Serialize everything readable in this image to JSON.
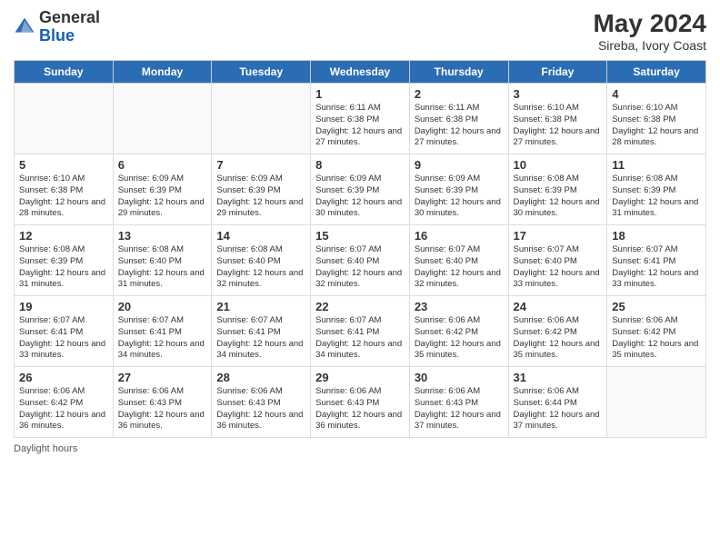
{
  "header": {
    "logo_general": "General",
    "logo_blue": "Blue",
    "month_year": "May 2024",
    "location": "Sireba, Ivory Coast"
  },
  "footer": {
    "daylight_label": "Daylight hours"
  },
  "days_of_week": [
    "Sunday",
    "Monday",
    "Tuesday",
    "Wednesday",
    "Thursday",
    "Friday",
    "Saturday"
  ],
  "weeks": [
    [
      {
        "day": "",
        "empty": true
      },
      {
        "day": "",
        "empty": true
      },
      {
        "day": "",
        "empty": true
      },
      {
        "day": "1",
        "sunrise": "Sunrise: 6:11 AM",
        "sunset": "Sunset: 6:38 PM",
        "daylight": "Daylight: 12 hours and 27 minutes."
      },
      {
        "day": "2",
        "sunrise": "Sunrise: 6:11 AM",
        "sunset": "Sunset: 6:38 PM",
        "daylight": "Daylight: 12 hours and 27 minutes."
      },
      {
        "day": "3",
        "sunrise": "Sunrise: 6:10 AM",
        "sunset": "Sunset: 6:38 PM",
        "daylight": "Daylight: 12 hours and 27 minutes."
      },
      {
        "day": "4",
        "sunrise": "Sunrise: 6:10 AM",
        "sunset": "Sunset: 6:38 PM",
        "daylight": "Daylight: 12 hours and 28 minutes."
      }
    ],
    [
      {
        "day": "5",
        "sunrise": "Sunrise: 6:10 AM",
        "sunset": "Sunset: 6:38 PM",
        "daylight": "Daylight: 12 hours and 28 minutes."
      },
      {
        "day": "6",
        "sunrise": "Sunrise: 6:09 AM",
        "sunset": "Sunset: 6:39 PM",
        "daylight": "Daylight: 12 hours and 29 minutes."
      },
      {
        "day": "7",
        "sunrise": "Sunrise: 6:09 AM",
        "sunset": "Sunset: 6:39 PM",
        "daylight": "Daylight: 12 hours and 29 minutes."
      },
      {
        "day": "8",
        "sunrise": "Sunrise: 6:09 AM",
        "sunset": "Sunset: 6:39 PM",
        "daylight": "Daylight: 12 hours and 30 minutes."
      },
      {
        "day": "9",
        "sunrise": "Sunrise: 6:09 AM",
        "sunset": "Sunset: 6:39 PM",
        "daylight": "Daylight: 12 hours and 30 minutes."
      },
      {
        "day": "10",
        "sunrise": "Sunrise: 6:08 AM",
        "sunset": "Sunset: 6:39 PM",
        "daylight": "Daylight: 12 hours and 30 minutes."
      },
      {
        "day": "11",
        "sunrise": "Sunrise: 6:08 AM",
        "sunset": "Sunset: 6:39 PM",
        "daylight": "Daylight: 12 hours and 31 minutes."
      }
    ],
    [
      {
        "day": "12",
        "sunrise": "Sunrise: 6:08 AM",
        "sunset": "Sunset: 6:39 PM",
        "daylight": "Daylight: 12 hours and 31 minutes."
      },
      {
        "day": "13",
        "sunrise": "Sunrise: 6:08 AM",
        "sunset": "Sunset: 6:40 PM",
        "daylight": "Daylight: 12 hours and 31 minutes."
      },
      {
        "day": "14",
        "sunrise": "Sunrise: 6:08 AM",
        "sunset": "Sunset: 6:40 PM",
        "daylight": "Daylight: 12 hours and 32 minutes."
      },
      {
        "day": "15",
        "sunrise": "Sunrise: 6:07 AM",
        "sunset": "Sunset: 6:40 PM",
        "daylight": "Daylight: 12 hours and 32 minutes."
      },
      {
        "day": "16",
        "sunrise": "Sunrise: 6:07 AM",
        "sunset": "Sunset: 6:40 PM",
        "daylight": "Daylight: 12 hours and 32 minutes."
      },
      {
        "day": "17",
        "sunrise": "Sunrise: 6:07 AM",
        "sunset": "Sunset: 6:40 PM",
        "daylight": "Daylight: 12 hours and 33 minutes."
      },
      {
        "day": "18",
        "sunrise": "Sunrise: 6:07 AM",
        "sunset": "Sunset: 6:41 PM",
        "daylight": "Daylight: 12 hours and 33 minutes."
      }
    ],
    [
      {
        "day": "19",
        "sunrise": "Sunrise: 6:07 AM",
        "sunset": "Sunset: 6:41 PM",
        "daylight": "Daylight: 12 hours and 33 minutes."
      },
      {
        "day": "20",
        "sunrise": "Sunrise: 6:07 AM",
        "sunset": "Sunset: 6:41 PM",
        "daylight": "Daylight: 12 hours and 34 minutes."
      },
      {
        "day": "21",
        "sunrise": "Sunrise: 6:07 AM",
        "sunset": "Sunset: 6:41 PM",
        "daylight": "Daylight: 12 hours and 34 minutes."
      },
      {
        "day": "22",
        "sunrise": "Sunrise: 6:07 AM",
        "sunset": "Sunset: 6:41 PM",
        "daylight": "Daylight: 12 hours and 34 minutes."
      },
      {
        "day": "23",
        "sunrise": "Sunrise: 6:06 AM",
        "sunset": "Sunset: 6:42 PM",
        "daylight": "Daylight: 12 hours and 35 minutes."
      },
      {
        "day": "24",
        "sunrise": "Sunrise: 6:06 AM",
        "sunset": "Sunset: 6:42 PM",
        "daylight": "Daylight: 12 hours and 35 minutes."
      },
      {
        "day": "25",
        "sunrise": "Sunrise: 6:06 AM",
        "sunset": "Sunset: 6:42 PM",
        "daylight": "Daylight: 12 hours and 35 minutes."
      }
    ],
    [
      {
        "day": "26",
        "sunrise": "Sunrise: 6:06 AM",
        "sunset": "Sunset: 6:42 PM",
        "daylight": "Daylight: 12 hours and 36 minutes."
      },
      {
        "day": "27",
        "sunrise": "Sunrise: 6:06 AM",
        "sunset": "Sunset: 6:43 PM",
        "daylight": "Daylight: 12 hours and 36 minutes."
      },
      {
        "day": "28",
        "sunrise": "Sunrise: 6:06 AM",
        "sunset": "Sunset: 6:43 PM",
        "daylight": "Daylight: 12 hours and 36 minutes."
      },
      {
        "day": "29",
        "sunrise": "Sunrise: 6:06 AM",
        "sunset": "Sunset: 6:43 PM",
        "daylight": "Daylight: 12 hours and 36 minutes."
      },
      {
        "day": "30",
        "sunrise": "Sunrise: 6:06 AM",
        "sunset": "Sunset: 6:43 PM",
        "daylight": "Daylight: 12 hours and 37 minutes."
      },
      {
        "day": "31",
        "sunrise": "Sunrise: 6:06 AM",
        "sunset": "Sunset: 6:44 PM",
        "daylight": "Daylight: 12 hours and 37 minutes."
      },
      {
        "day": "",
        "empty": true
      }
    ]
  ]
}
